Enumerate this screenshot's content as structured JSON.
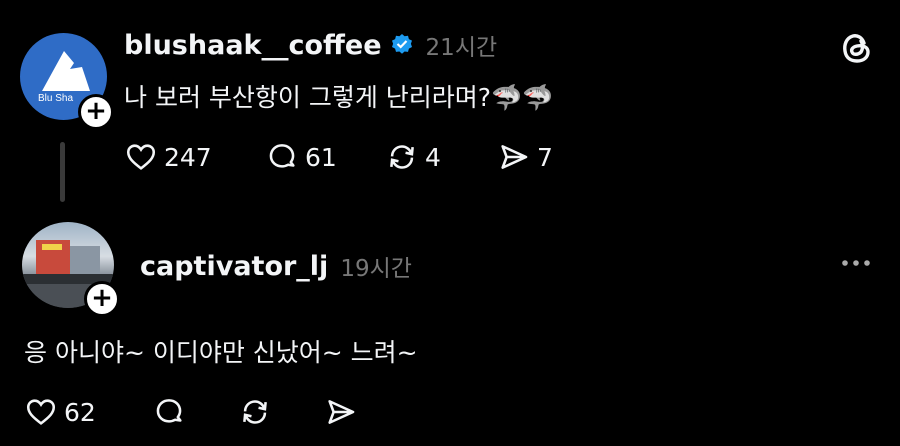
{
  "post": {
    "username": "blushaak__coffee",
    "avatar_text": "Blu Sha",
    "time": "21시간",
    "text": "나 보러 부산항이 그렇게 난리라며?",
    "emoji": "🦈🦈",
    "likes": "247",
    "replies": "61",
    "reposts": "4",
    "shares": "7",
    "verified_icon": "verified-badge-icon",
    "app_icon": "threads-logo-icon"
  },
  "reply": {
    "username": "captivator_lj",
    "time": "19시간",
    "text": "응 아니야~ 이디야만 신났어~ 느려~",
    "likes": "62",
    "more_icon": "more-icon"
  },
  "colors": {
    "background": "#000000",
    "text": "#f3f5f7",
    "muted": "#777777",
    "verified": "#1d9bf0"
  }
}
